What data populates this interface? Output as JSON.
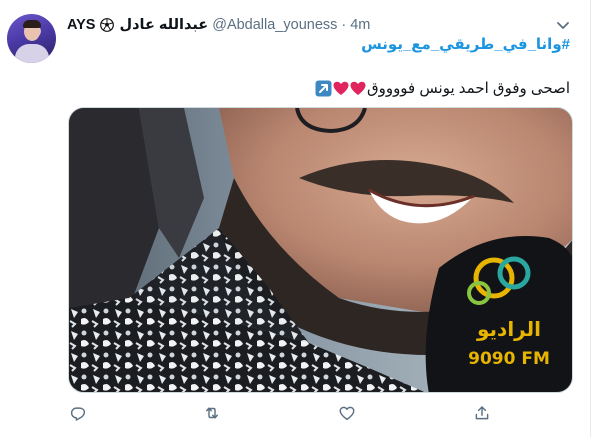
{
  "tweet": {
    "display_name": "عبدالله عادل",
    "name_prefix": "AYS",
    "handle": "@Abdalla_youness",
    "separator": "·",
    "time": "4m",
    "hashtag": "#وانا_في_طريقي_مع_يونس",
    "text": "اصحى وفوق احمد يونس فووووق",
    "emojis": [
      "red-heart",
      "red-heart",
      "up-right-arrow"
    ],
    "media": {
      "description_icon": "photo",
      "logo_text_ar": "الراديو",
      "logo_text_fm": "9090 FM"
    }
  },
  "actions": [
    "reply-icon",
    "retweet-icon",
    "like-icon",
    "share-icon"
  ],
  "colors": {
    "link": "#1b95e0",
    "secondary_text": "#5b7083",
    "heart": "#e0245e",
    "icon": "#5b7083"
  }
}
